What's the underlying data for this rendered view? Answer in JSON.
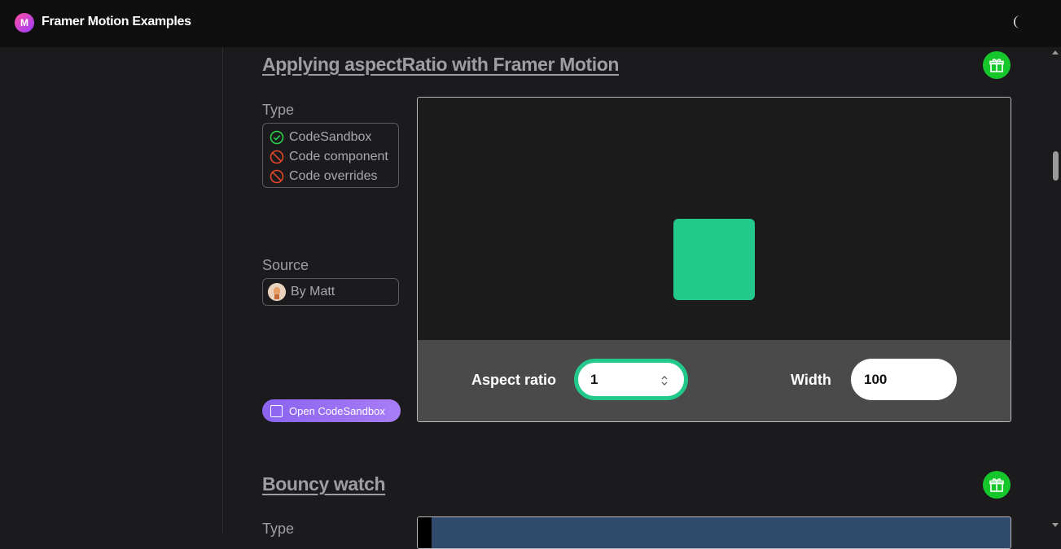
{
  "header": {
    "logo_letter": "M",
    "title": "Framer Motion Examples",
    "theme_toggle_icon": "moon-icon"
  },
  "examples": [
    {
      "title": "Applying aspectRatio with Framer Motion",
      "type_label": "Type",
      "types": [
        {
          "label": "CodeSandbox",
          "status": "supported",
          "icon": "check-circle-icon",
          "color": "#2bd14a"
        },
        {
          "label": "Code component",
          "status": "unsupported",
          "icon": "blocked-icon",
          "color": "#e2462c"
        },
        {
          "label": "Code overrides",
          "status": "unsupported",
          "icon": "blocked-icon",
          "color": "#e2462c"
        }
      ],
      "source_label": "Source",
      "source": "By Matt",
      "open_button": "Open CodeSandbox",
      "demo": {
        "box_color": "#22c98a",
        "aspect_ratio_label": "Aspect ratio",
        "aspect_ratio_value": "1",
        "width_label": "Width",
        "width_value": "100"
      }
    },
    {
      "title": "Bouncy watch",
      "type_label": "Type"
    }
  ],
  "colors": {
    "accent_green": "#16c72c",
    "box_green": "#22c98a",
    "button_purple": "#8a63f0"
  }
}
